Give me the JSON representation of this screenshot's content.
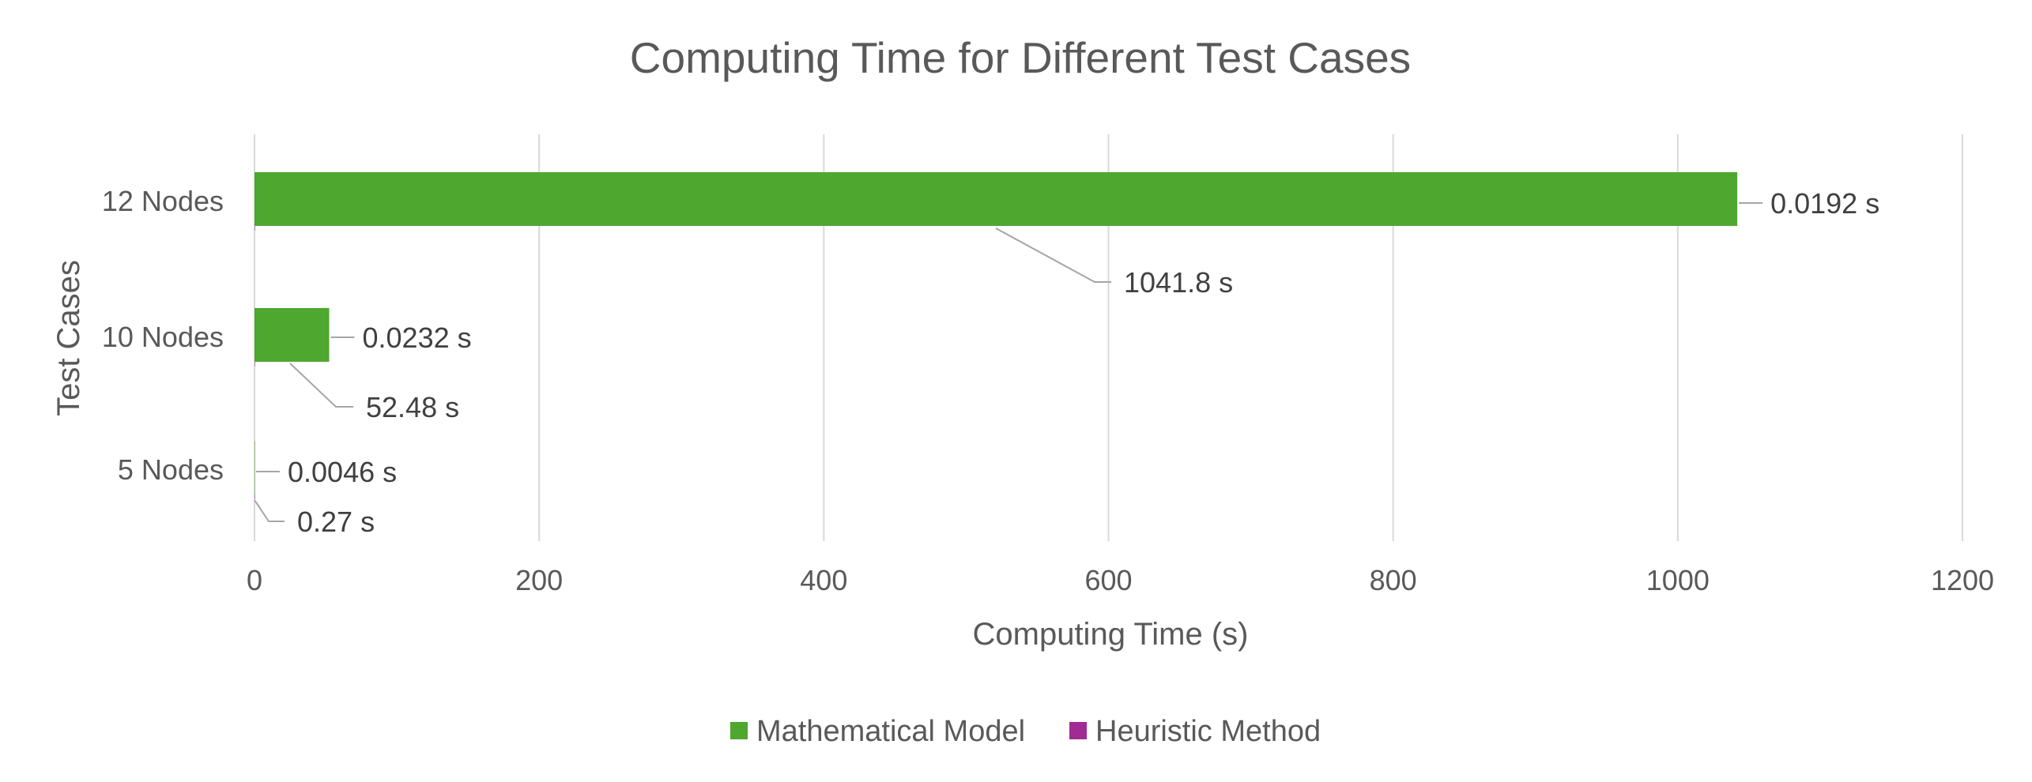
{
  "chart_data": {
    "type": "bar",
    "orientation": "horizontal",
    "title": "Computing Time for Different Test Cases",
    "xlabel": "Computing Time (s)",
    "ylabel": "Test Cases",
    "categories": [
      "5 Nodes",
      "10 Nodes",
      "12 Nodes"
    ],
    "xlim": [
      0,
      1200
    ],
    "xticks": [
      0,
      200,
      400,
      600,
      800,
      1000,
      1200
    ],
    "grid": "vertical",
    "legend_position": "bottom",
    "series": [
      {
        "name": "Mathematical Model",
        "color": "#4EA72E",
        "values": [
          0.27,
          52.48,
          1041.8
        ],
        "labels": [
          "0.27 s",
          "52.48 s",
          "1041.8 s"
        ]
      },
      {
        "name": "Heuristic Method",
        "color": "#A02B93",
        "values": [
          0.0046,
          0.0232,
          0.0192
        ],
        "labels": [
          "0.0046 s",
          "0.0232 s",
          "0.0192 s"
        ]
      }
    ]
  }
}
